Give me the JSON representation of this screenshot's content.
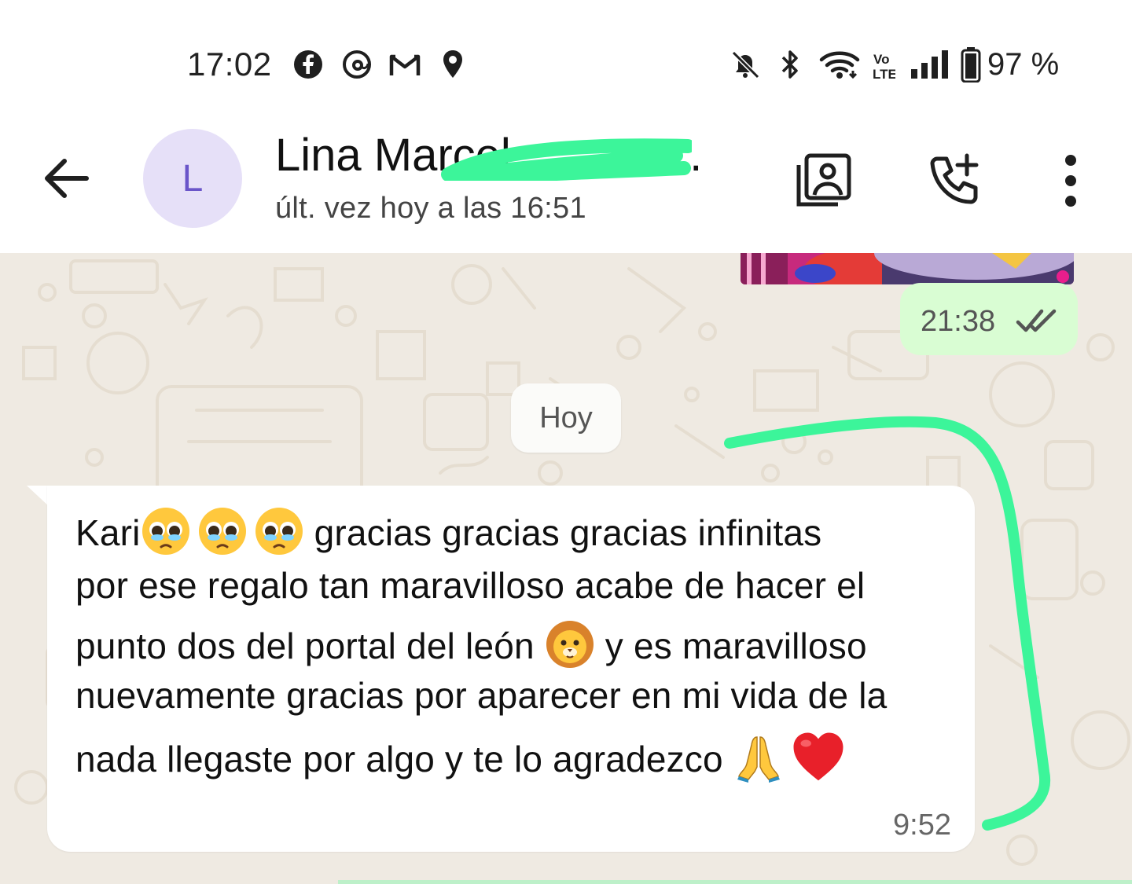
{
  "status_bar": {
    "time": "17:02",
    "notification_icons": [
      "facebook-icon",
      "threads-icon",
      "gmail-icon",
      "location-icon"
    ],
    "system_icons": [
      "mute-icon",
      "bluetooth-icon",
      "wifi-icon",
      "volte-icon",
      "signal-icon",
      "battery-icon"
    ],
    "battery_percent": "97 %"
  },
  "header": {
    "avatar_letter": "L",
    "contact_name": "Lina Marcel",
    "contact_name_ellipsis": "…",
    "last_seen": "últ. vez hoy a las 16:51",
    "actions": [
      "video-call-icon",
      "add-call-icon",
      "more-options-icon"
    ]
  },
  "chat": {
    "outgoing": {
      "time": "21:38",
      "status": "read"
    },
    "date_separator": "Hoy",
    "incoming": {
      "lines": {
        "l1a": "Kari",
        "l1b": " gracias gracias gracias infinitas",
        "l2": "por ese regalo tan maravilloso acabe de hacer el",
        "l3a": "punto dos del portal del león ",
        "l3b": " y es maravilloso",
        "l4": "nuevamente gracias por aparecer en mi vida de la",
        "l5a": "nada llegaste por algo y te lo agradezco "
      },
      "emojis": [
        "pleading-face",
        "pleading-face",
        "pleading-face",
        "lion-face",
        "folded-hands",
        "red-heart"
      ],
      "time": "9:52"
    }
  },
  "colors": {
    "chat_background": "#efeae2",
    "outgoing_bubble": "#d9fdd3",
    "incoming_bubble": "#ffffff",
    "avatar_bg": "#e6e0f8",
    "avatar_fg": "#6a55c9",
    "read_ticks": "#555555",
    "highlight_scribble": "#3cf59a"
  }
}
